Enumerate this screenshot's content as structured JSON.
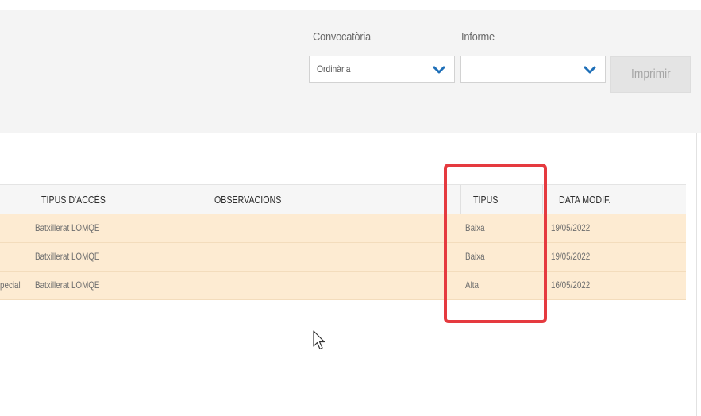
{
  "filters": {
    "convocatoria": {
      "label": "Convocatòria",
      "value": "Ordinària"
    },
    "informe": {
      "label": "Informe",
      "value": ""
    },
    "print_button": "Imprimir"
  },
  "table": {
    "columns": [
      "TIPUS D'ACCÉS",
      "OBSERVACIONS",
      "TIPUS",
      "DATA MODIF."
    ],
    "rows": [
      {
        "partial": "",
        "tipus_acces": "Batxillerat LOMQE",
        "observacions": "",
        "tipus": "Baixa",
        "data_modif": "19/05/2022"
      },
      {
        "partial": "",
        "tipus_acces": "Batxillerat LOMQE",
        "observacions": "",
        "tipus": "Baixa",
        "data_modif": "19/05/2022"
      },
      {
        "partial": "pecial",
        "tipus_acces": "Batxillerat LOMQE",
        "observacions": "",
        "tipus": "Alta",
        "data_modif": "16/05/2022"
      }
    ]
  },
  "colors": {
    "row_highlight": "#fdebd2",
    "chevron": "#1e6fb8",
    "annotation_box": "#e53a3f"
  },
  "icons": {
    "select_arrow": "chevron-down-icon",
    "cursor": "mouse-pointer-icon"
  }
}
